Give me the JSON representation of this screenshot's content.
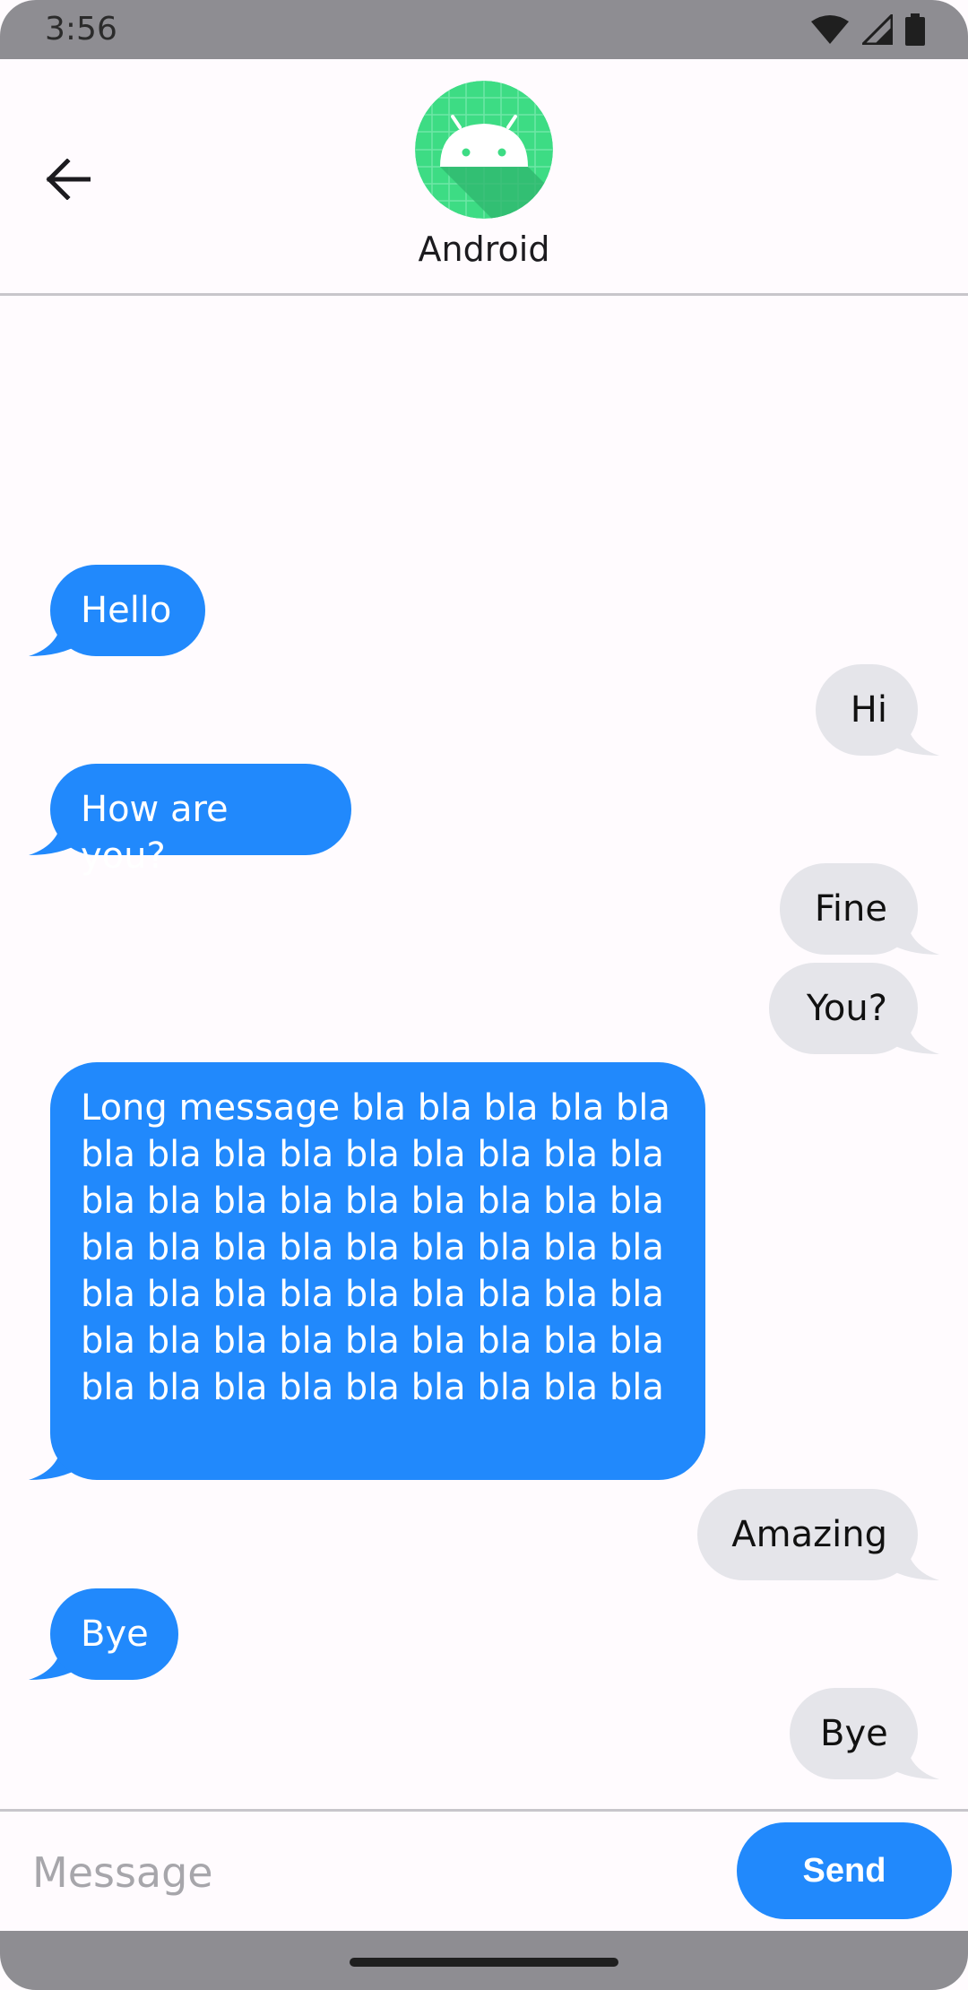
{
  "status_bar": {
    "time": "3:56"
  },
  "header": {
    "contact_name": "Android"
  },
  "messages": [
    {
      "sender": "in",
      "text": "Hello"
    },
    {
      "sender": "out",
      "text": "Hi"
    },
    {
      "sender": "in",
      "text": "How are you?"
    },
    {
      "sender": "out",
      "text": "Fine"
    },
    {
      "sender": "out",
      "text": "You?"
    },
    {
      "sender": "in",
      "text": "Long message bla bla bla bla bla bla bla bla bla bla bla bla bla bla bla bla bla bla bla bla bla bla bla bla bla bla bla bla bla bla bla bla bla bla bla bla bla bla bla bla bla bla bla bla bla bla bla bla bla bla bla bla bla bla bla bla bla bla bla"
    },
    {
      "sender": "out",
      "text": "Amazing"
    },
    {
      "sender": "in",
      "text": "Bye"
    },
    {
      "sender": "out",
      "text": "Bye"
    }
  ],
  "composer": {
    "placeholder": "Message",
    "send_label": "Send"
  },
  "colors": {
    "incoming": "#2189fc",
    "outgoing": "#e5e5ea",
    "accent": "#2189fc"
  }
}
